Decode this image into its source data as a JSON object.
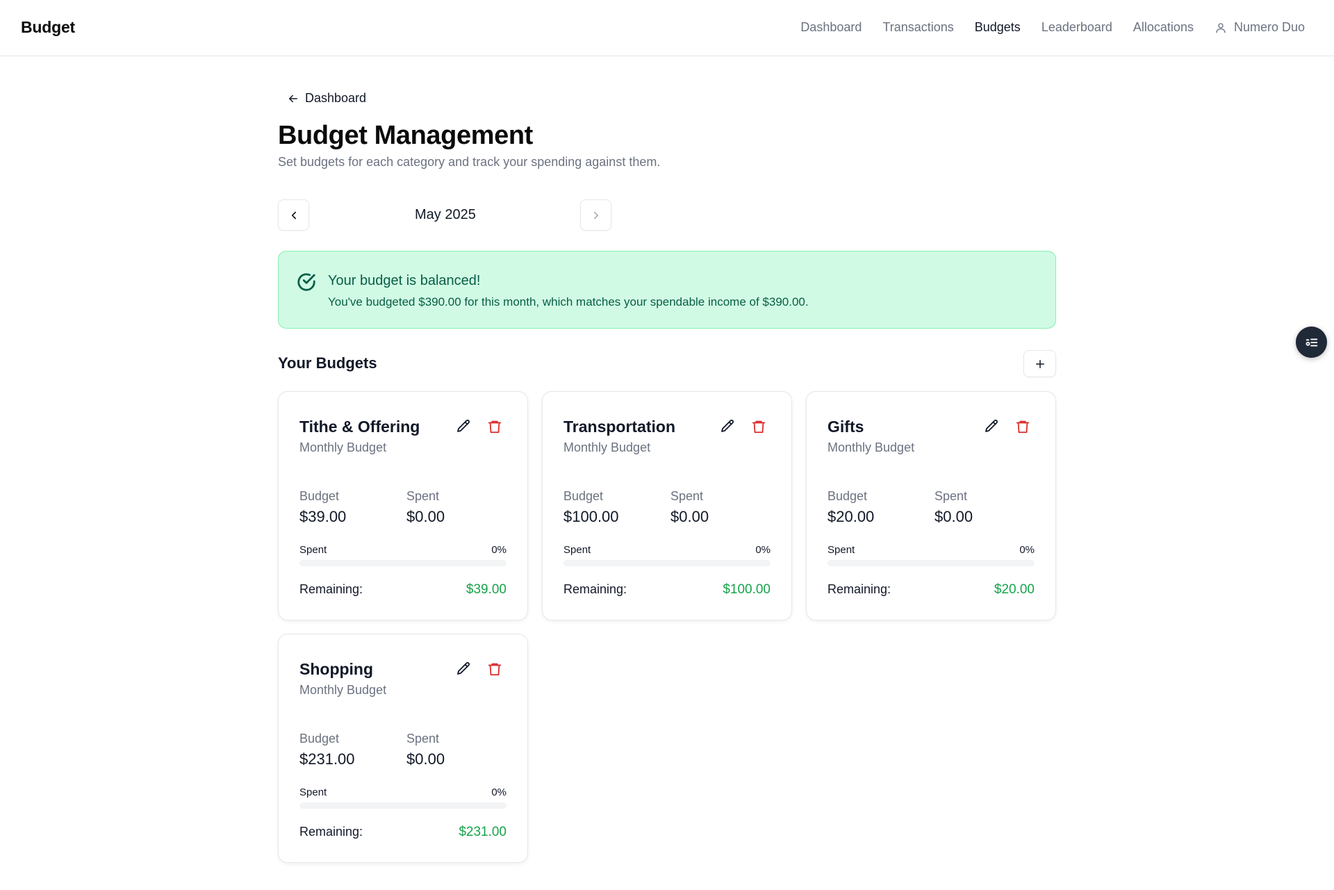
{
  "brand": "Budget",
  "nav": {
    "items": [
      {
        "label": "Dashboard",
        "active": false
      },
      {
        "label": "Transactions",
        "active": false
      },
      {
        "label": "Budgets",
        "active": true
      },
      {
        "label": "Leaderboard",
        "active": false
      },
      {
        "label": "Allocations",
        "active": false
      }
    ],
    "user": "Numero Duo"
  },
  "back_link": "Dashboard",
  "page": {
    "title": "Budget Management",
    "subtitle": "Set budgets for each category and track your spending against them."
  },
  "month": "May 2025",
  "alert": {
    "title": "Your budget is balanced!",
    "text": "You've budgeted $390.00 for this month, which matches your spendable income of $390.00."
  },
  "section_title": "Your Budgets",
  "labels": {
    "budget": "Budget",
    "spent": "Spent",
    "progress": "Spent",
    "remaining": "Remaining:"
  },
  "budgets": [
    {
      "name": "Tithe & Offering",
      "period": "Monthly Budget",
      "budget": "$39.00",
      "spent": "$0.00",
      "percent": "0%",
      "progress": 0,
      "remaining": "$39.00"
    },
    {
      "name": "Transportation",
      "period": "Monthly Budget",
      "budget": "$100.00",
      "spent": "$0.00",
      "percent": "0%",
      "progress": 0,
      "remaining": "$100.00"
    },
    {
      "name": "Gifts",
      "period": "Monthly Budget",
      "budget": "$20.00",
      "spent": "$0.00",
      "percent": "0%",
      "progress": 0,
      "remaining": "$20.00"
    },
    {
      "name": "Shopping",
      "period": "Monthly Budget",
      "budget": "$231.00",
      "spent": "$0.00",
      "percent": "0%",
      "progress": 0,
      "remaining": "$231.00"
    }
  ],
  "colors": {
    "accent_green": "#16a34a",
    "alert_bg": "#d1fae5",
    "danger": "#dc2626"
  },
  "icons": {
    "back": "arrow-left-icon",
    "prev": "chevron-left-icon",
    "next": "chevron-right-icon",
    "add": "plus-icon",
    "edit": "pencil-icon",
    "delete": "trash-icon",
    "user": "user-icon",
    "alert": "check-circle-icon",
    "fab": "list-settings-icon"
  }
}
